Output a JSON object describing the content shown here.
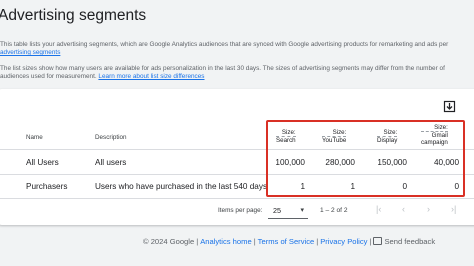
{
  "page": {
    "title": "Advertising segments",
    "description_lines": [
      "This table lists your advertising segments, which are Google Analytics audiences that are synced with Google advertising products for remarketing and ads per",
      "advertising segments"
    ],
    "size_note_lines": [
      "The list sizes show how many users are available for ads personalization in the last 30 days. The sizes of advertising segments may differ from the number of",
      "audiences used for measurement."
    ],
    "size_note_link": "Learn more about list size differences"
  },
  "table": {
    "download_icon": "download-icon",
    "columns": {
      "name": "Name",
      "description": "Description",
      "search": {
        "top": "Size:",
        "bottom": "Search"
      },
      "youtube": {
        "top": "Size:",
        "bottom": "YouTube"
      },
      "display": {
        "top": "Size:",
        "bottom": "Display"
      },
      "gmail": {
        "top": "Size:",
        "mid": "Gmail",
        "bottom": "campaign"
      }
    },
    "rows": [
      {
        "name": "All Users",
        "description": "All users",
        "search": "100,000",
        "youtube": "280,000",
        "display": "150,000",
        "gmail": "40,000"
      },
      {
        "name": "Purchasers",
        "description": "Users who have purchased in the last 540 days",
        "search": "1",
        "youtube": "1",
        "display": "0",
        "gmail": "0"
      }
    ],
    "highlight_color": "#d93025"
  },
  "pagination": {
    "items_label": "Items per page:",
    "items_value": "25",
    "range": "1 – 2 of 2",
    "icons": [
      "first-page-icon",
      "prev-page-icon",
      "next-page-icon",
      "last-page-icon"
    ]
  },
  "footer": {
    "copyright": "© 2024 Google",
    "links": [
      "Analytics home",
      "Terms of Service",
      "Privacy Policy"
    ],
    "feedback": "Send feedback"
  }
}
